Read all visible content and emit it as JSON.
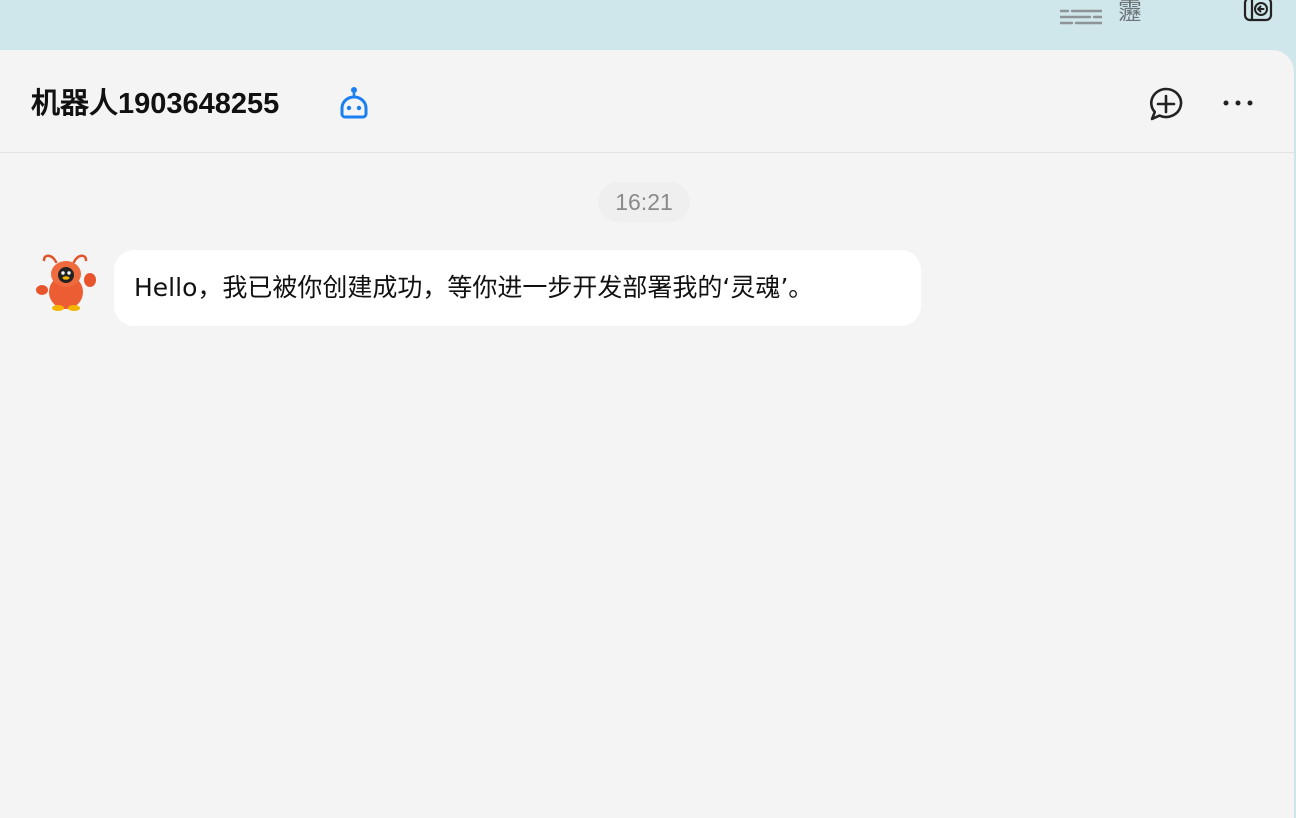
{
  "topbar": {
    "char": "靋"
  },
  "header": {
    "title": "机器人1903648255"
  },
  "messages": [
    {
      "time": "16:21",
      "text": "Hello，我已被你创建成功，等你进一步开发部署我的‘灵魂’。"
    }
  ],
  "colors": {
    "accent": "#1a7ff0",
    "background": "#f4f4f4",
    "topbar": "#cfe6ea",
    "bubble": "#ffffff"
  },
  "icons": [
    "list-lines-icon",
    "collapse-sidebar-icon",
    "bot-icon",
    "new-chat-icon",
    "more-icon",
    "lobster-avatar"
  ]
}
